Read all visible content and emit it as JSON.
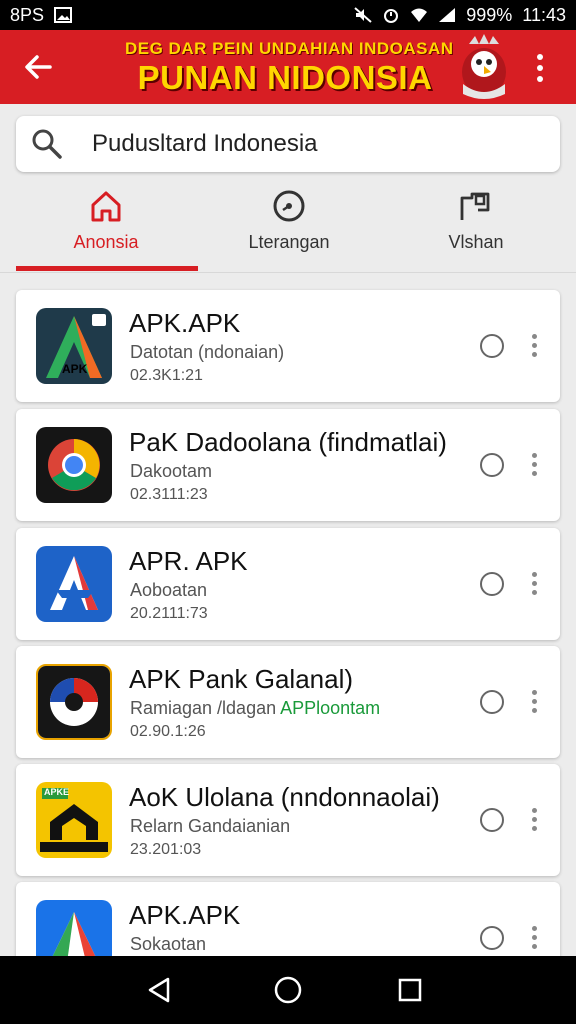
{
  "status_bar": {
    "left_text": "8PS",
    "battery_text": "999%",
    "time": "11:43"
  },
  "app_bar": {
    "banner_line1": "DEG DAR PEIN UNDAHIAN INDOASAN",
    "banner_line2": "PUNAN NIDONSIA"
  },
  "search": {
    "value": "Pudusltard Indonesia",
    "icon": "search-icon"
  },
  "tabs": [
    {
      "label": "Anonsia",
      "icon": "home-icon",
      "active": true
    },
    {
      "label": "Lterangan",
      "icon": "clock-icon",
      "active": false
    },
    {
      "label": "Vlshan",
      "icon": "flag-icon",
      "active": false
    }
  ],
  "colors": {
    "accent": "#d71e23",
    "banner_text": "#ffd600",
    "background": "#ececec"
  },
  "apps": [
    {
      "title": "APK.APK",
      "subtitle": "Datotan (ndonaian)",
      "date": "02.3K1:21",
      "icon_label": "APK"
    },
    {
      "title": "PaK Dadoolana (findmatlai)",
      "subtitle": "Dakootam",
      "date": "02.3111:23",
      "icon_label": ""
    },
    {
      "title": "APR. APK",
      "subtitle": "Aoboatan",
      "date": "20.2111:73",
      "icon_label": ""
    },
    {
      "title": "APK Pank Galanal)",
      "subtitle": "Ramiagan /ldagan",
      "subtitle_accent": "APPloontam",
      "date": "02.90.1:26",
      "icon_label": ""
    },
    {
      "title": "AoK Ulolana (nndonnaolai)",
      "subtitle": "Relarn Gandaianian",
      "date": "23.201:03",
      "icon_label": "APKE"
    },
    {
      "title": "APK.APK",
      "subtitle": "Sokaotan",
      "date": "",
      "icon_label": ""
    }
  ]
}
